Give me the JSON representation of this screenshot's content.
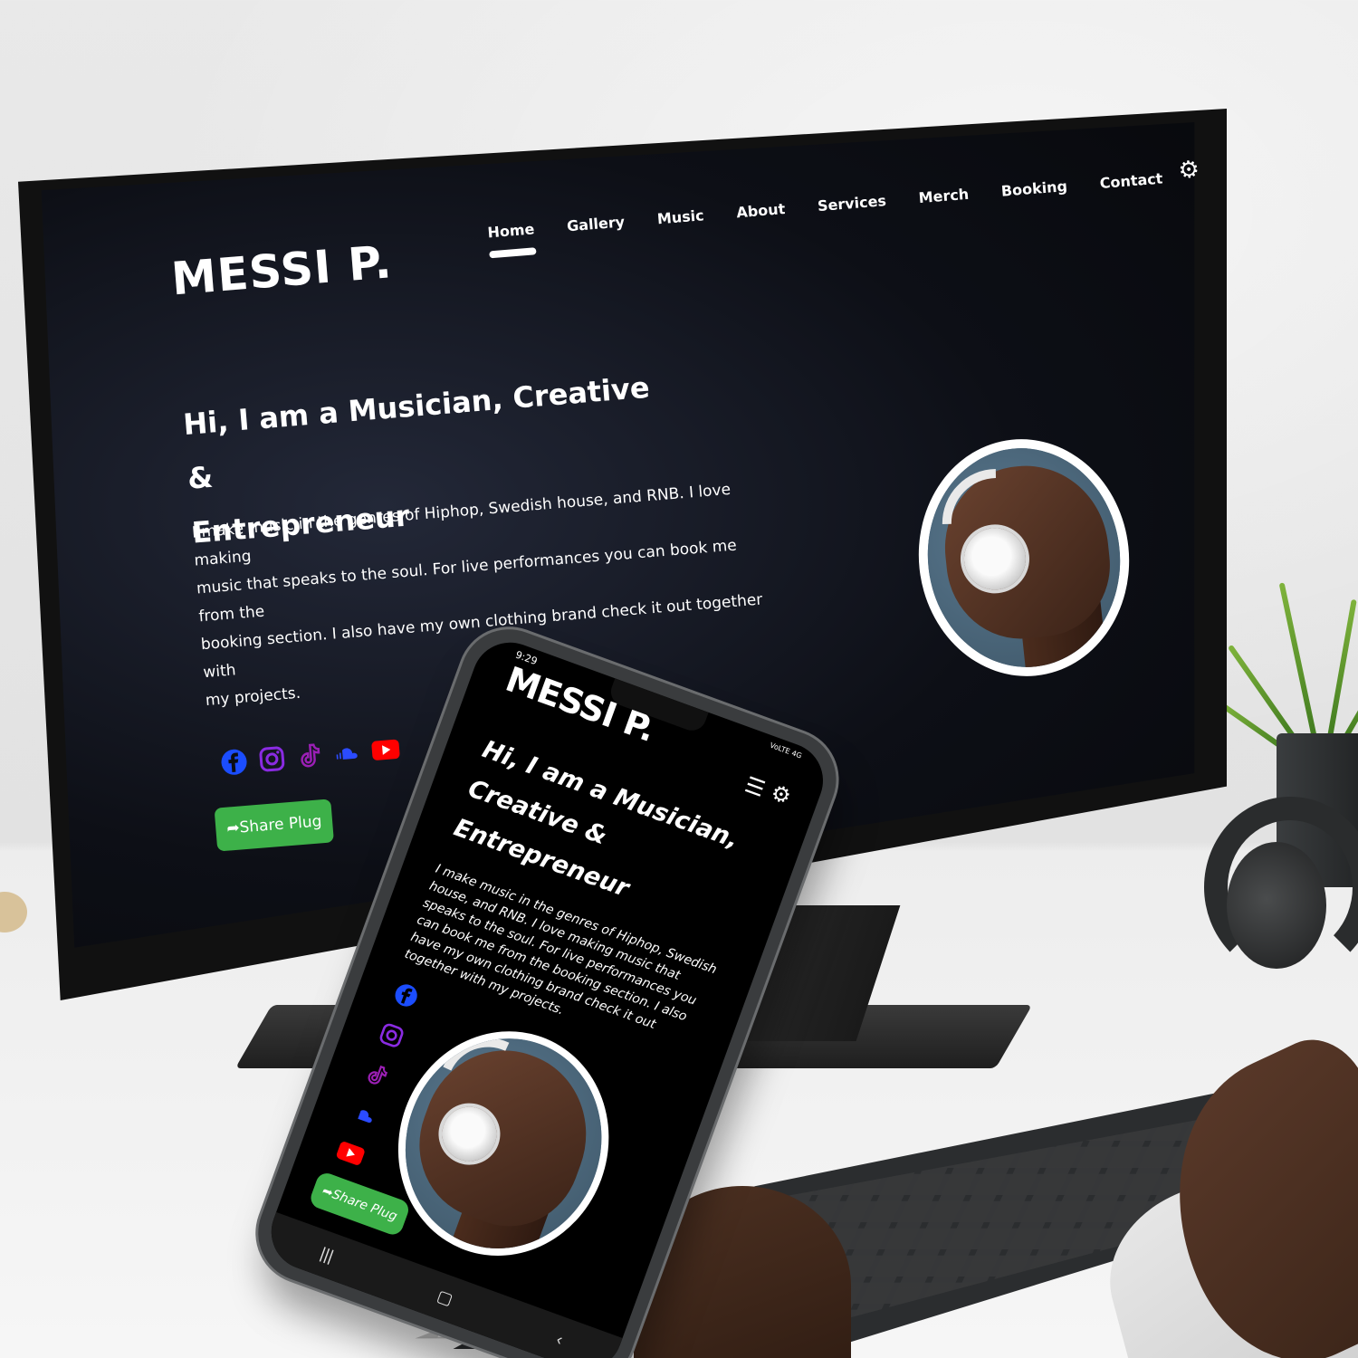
{
  "desktop": {
    "brand": "MESSI P.",
    "nav": {
      "items": [
        {
          "label": "Home",
          "active": true
        },
        {
          "label": "Gallery",
          "active": false
        },
        {
          "label": "Music",
          "active": false
        },
        {
          "label": "About",
          "active": false
        },
        {
          "label": "Services",
          "active": false
        },
        {
          "label": "Merch",
          "active": false
        },
        {
          "label": "Booking",
          "active": false
        },
        {
          "label": "Contact",
          "active": false
        }
      ],
      "theme_icon": "gear-icon"
    },
    "hero": {
      "title_line1": "Hi, I am a Musician, Creative &",
      "title_line2": "Entrepreneur",
      "text_line1": "I make music in the genres of Hiphop, Swedish house, and RNB. I love making",
      "text_line2": "music that speaks to the soul. For live performances you can book me from the",
      "text_line3": "booking section. I also have my own clothing brand check it out together with",
      "text_line4": "my projects."
    },
    "socials": [
      "facebook-icon",
      "instagram-icon",
      "tiktok-icon",
      "soundcloud-icon",
      "youtube-icon"
    ],
    "share_button": "Share Plug"
  },
  "mobile": {
    "status_time": "9:29",
    "status_right": "VoLTE 4G",
    "brand": "MESSI P.",
    "title_line1": "Hi, I am a Musician,",
    "title_line2": "Creative &",
    "title_line3": "Entrepreneur",
    "text": "I make music in the genres of Hiphop, Swedish house, and RNB. I love making music that speaks to the soul. For live performances you can book me from the booking section. I also have my own clothing brand check it out together with my projects.",
    "share_button": "Share Plug",
    "nav_bar": [
      "|||",
      "▢",
      "‹"
    ]
  },
  "colors": {
    "share_green": "#3db149",
    "facebook": "#1b4dff",
    "instagram": "#8a2be2",
    "tiktok": "#9b1fb5",
    "soundcloud": "#2b4bff",
    "youtube": "#ff0000",
    "screen_bg": "#0b0d12"
  }
}
